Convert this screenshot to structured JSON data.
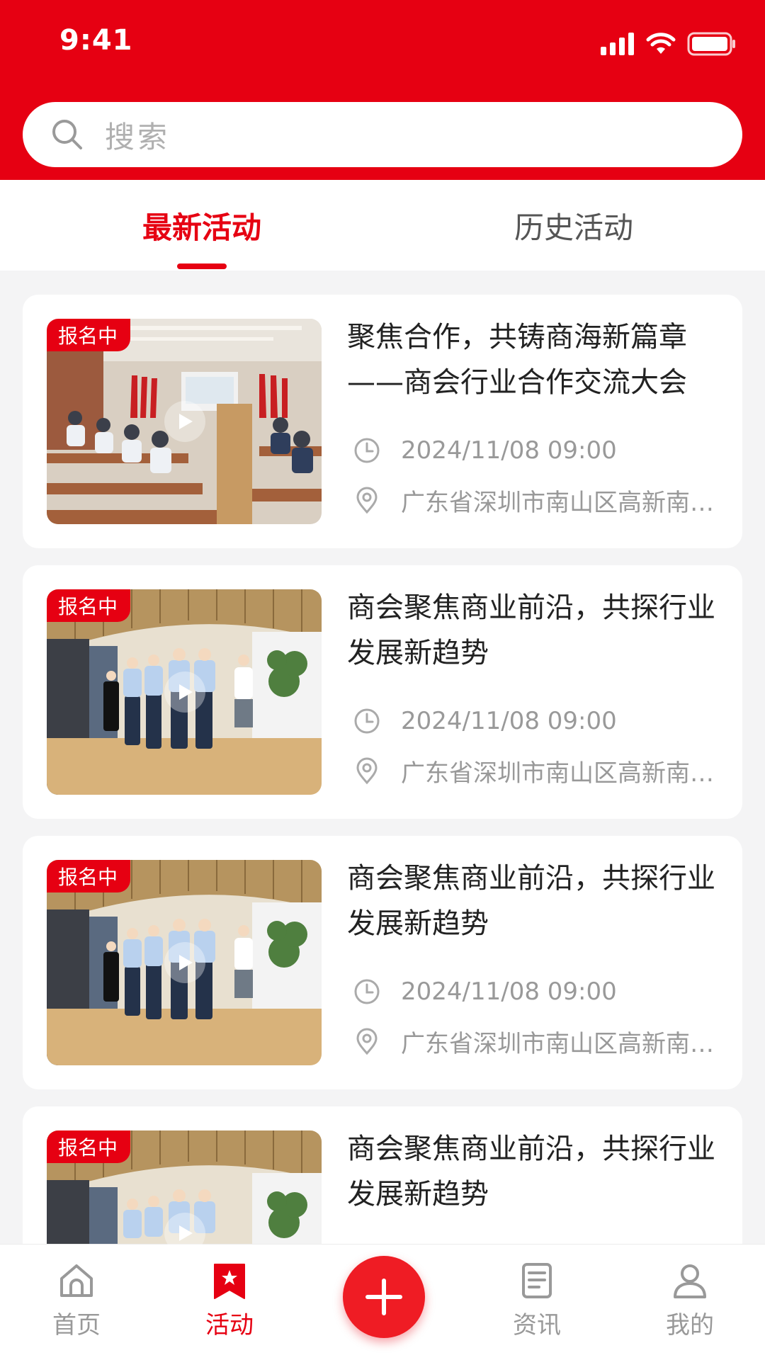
{
  "status_bar": {
    "time": "9:41"
  },
  "search": {
    "placeholder": "搜索"
  },
  "tabs": [
    {
      "label": "最新活动",
      "active": true
    },
    {
      "label": "历史活动",
      "active": false
    }
  ],
  "cards": [
    {
      "badge": "报名中",
      "title": "聚焦合作，共铸商海新篇章——商会行业合作交流大会",
      "time": "2024/11/08 09:00",
      "location": "广东省深圳市南山区高新南…",
      "image": "conference-room-photo"
    },
    {
      "badge": "报名中",
      "title": "商会聚焦商业前沿，共探行业发展新趋势",
      "time": "2024/11/08 09:00",
      "location": "广东省深圳市南山区高新南…",
      "image": "exhibition-hall-photo"
    },
    {
      "badge": "报名中",
      "title": "商会聚焦商业前沿，共探行业发展新趋势",
      "time": "2024/11/08 09:00",
      "location": "广东省深圳市南山区高新南…",
      "image": "exhibition-hall-photo"
    },
    {
      "badge": "报名中",
      "title": "商会聚焦商业前沿，共探行业发展新趋势",
      "image": "exhibition-hall-photo"
    }
  ],
  "bottom_nav": [
    {
      "label": "首页",
      "icon": "home-icon",
      "active": false
    },
    {
      "label": "活动",
      "icon": "activity-icon",
      "active": true
    },
    {
      "label": "",
      "icon": "plus-icon",
      "active": false
    },
    {
      "label": "资讯",
      "icon": "news-icon",
      "active": false
    },
    {
      "label": "我的",
      "icon": "user-icon",
      "active": false
    }
  ],
  "colors": {
    "brand": "#e60012",
    "background": "#f4f4f5",
    "muted": "#999999"
  }
}
